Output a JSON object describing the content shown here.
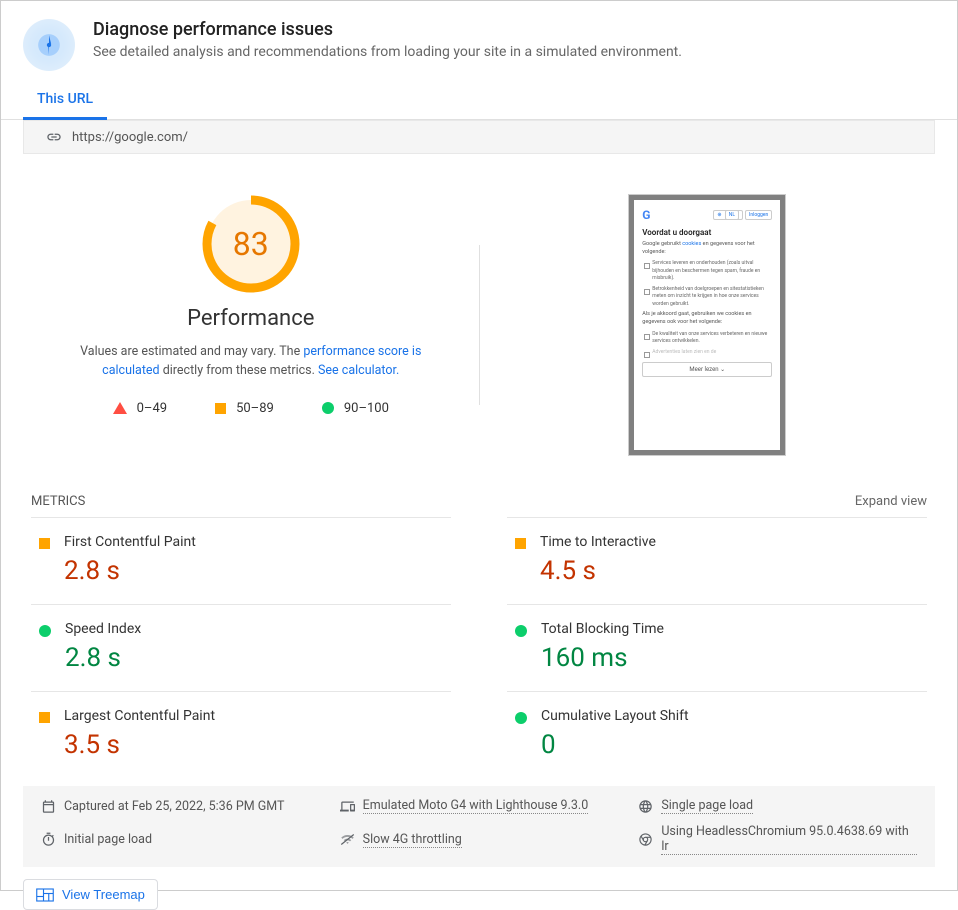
{
  "header": {
    "title": "Diagnose performance issues",
    "subtitle": "See detailed analysis and recommendations from loading your site in a simulated environment."
  },
  "tab": {
    "label": "This URL"
  },
  "url": "https://google.com/",
  "score": {
    "value": "83",
    "title": "Performance",
    "desc_prefix": "Values are estimated and may vary. The ",
    "desc_link1": "performance score is calculated",
    "desc_mid": " directly from these metrics. ",
    "desc_link2": "See calculator."
  },
  "legend": {
    "r1": "0–49",
    "r2": "50–89",
    "r3": "90–100"
  },
  "screenshot": {
    "chip1": "NL",
    "chip2": "Inloggen",
    "title": "Voordat u doorgaat",
    "t1a": "Google gebruikt ",
    "t1link": "cookies",
    "t1b": " en gegevens voor het volgende:",
    "li1": "Services leveren en onderhouden (zoals uitval bijhouden en beschermen tegen spam, fraude en misbruik).",
    "li2": "Betrokkenheid van doelgroepen en sitestatistieken meten om inzicht te krijgen in hoe onze services worden gebruikt.",
    "t2": "Als je akkoord gaat, gebruiken we cookies en gegevens ook voor het volgende:",
    "li3": "De kwaliteit van onze services verbeteren en nieuwe services ontwikkelen.",
    "li4": "Advertenties laten zien en de",
    "btn": "Meer lezen   ⌄"
  },
  "metrics": {
    "heading": "METRICS",
    "expand": "Expand view",
    "items": [
      {
        "name": "First Contentful Paint",
        "value": "2.8 s",
        "color": "orange",
        "shape": "sq"
      },
      {
        "name": "Time to Interactive",
        "value": "4.5 s",
        "color": "orange",
        "shape": "sq"
      },
      {
        "name": "Speed Index",
        "value": "2.8 s",
        "color": "green",
        "shape": "ci"
      },
      {
        "name": "Total Blocking Time",
        "value": "160 ms",
        "color": "green",
        "shape": "ci"
      },
      {
        "name": "Largest Contentful Paint",
        "value": "3.5 s",
        "color": "orange",
        "shape": "sq"
      },
      {
        "name": "Cumulative Layout Shift",
        "value": "0",
        "color": "green",
        "shape": "ci"
      }
    ]
  },
  "env": {
    "e1": "Captured at Feb 25, 2022, 5:36 PM GMT",
    "e2": "Emulated Moto G4 with Lighthouse 9.3.0",
    "e3": "Single page load",
    "e4": "Initial page load",
    "e5": "Slow 4G throttling",
    "e6": "Using HeadlessChromium 95.0.4638.69 with lr"
  },
  "treemap": {
    "label": "View Treemap"
  },
  "colors": {
    "orange": "#e67700"
  }
}
